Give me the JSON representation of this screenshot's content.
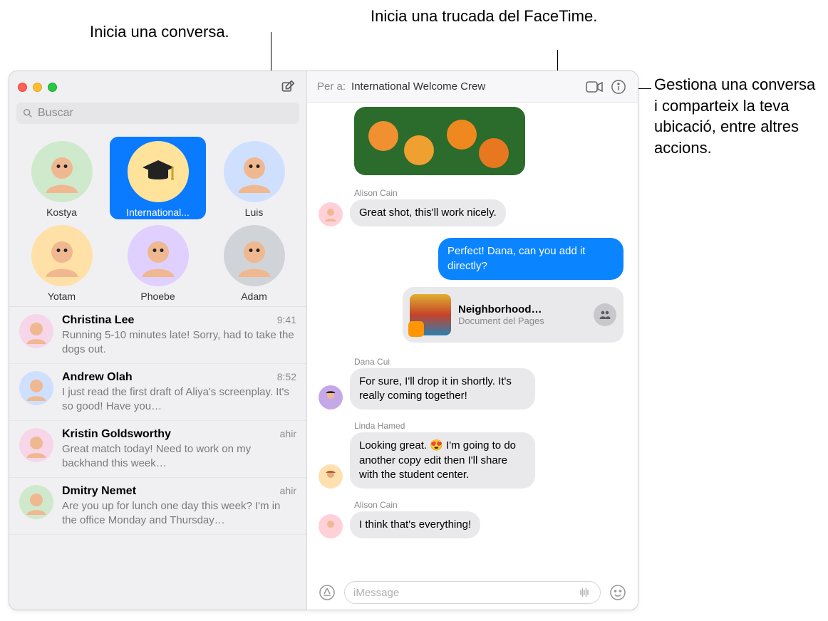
{
  "callouts": {
    "compose": "Inicia una conversa.",
    "facetime": "Inicia una trucada del FaceTime.",
    "info": "Gestiona una conversa i comparteix la teva ubicació, entre altres accions."
  },
  "search_placeholder": "Buscar",
  "header": {
    "to_label": "Per a:",
    "to_value": "International Welcome Crew"
  },
  "pins": [
    {
      "name": "Kostya",
      "bg": "#cfe9cc"
    },
    {
      "name": "International...",
      "bg": "#ffe39a",
      "sel": true,
      "icon": "cap"
    },
    {
      "name": "Luis",
      "bg": "#cfe0ff"
    },
    {
      "name": "Yotam",
      "bg": "#ffe0a6"
    },
    {
      "name": "Phoebe",
      "bg": "#e0d0ff"
    },
    {
      "name": "Adam",
      "bg": "#d0d4d8"
    }
  ],
  "conversations": [
    {
      "name": "Christina Lee",
      "time": "9:41",
      "preview": "Running 5-10 minutes late! Sorry, had to take the dogs out.",
      "bg": "#f6d6e8"
    },
    {
      "name": "Andrew Olah",
      "time": "8:52",
      "preview": "I just read the first draft of Aliya's screenplay. It's so good! Have you…",
      "bg": "#cfe0ff"
    },
    {
      "name": "Kristin Goldsworthy",
      "time": "ahir",
      "preview": "Great match today! Need to work on my backhand this week…",
      "bg": "#f6d6e8"
    },
    {
      "name": "Dmitry Nemet",
      "time": "ahir",
      "preview": "Are you up for lunch one day this week? I'm in the office Monday and Thursday…",
      "bg": "#cfe9cc"
    }
  ],
  "messages": {
    "m1_sender": "Alison Cain",
    "m1_text": "Great shot, this'll work nicely.",
    "m2_text": "Perfect! Dana, can you add it directly?",
    "doc_title": "Neighborhood…",
    "doc_sub": "Document del Pages",
    "m3_sender": "Dana Cui",
    "m3_text": "For sure, I'll drop it in shortly. It's really coming together!",
    "m4_sender": "Linda Hamed",
    "m4_text": "Looking great. 😍 I'm going to do another copy edit then I'll share with the student center.",
    "m5_sender": "Alison Cain",
    "m5_text": "I think that's everything!"
  },
  "input_placeholder": "iMessage"
}
